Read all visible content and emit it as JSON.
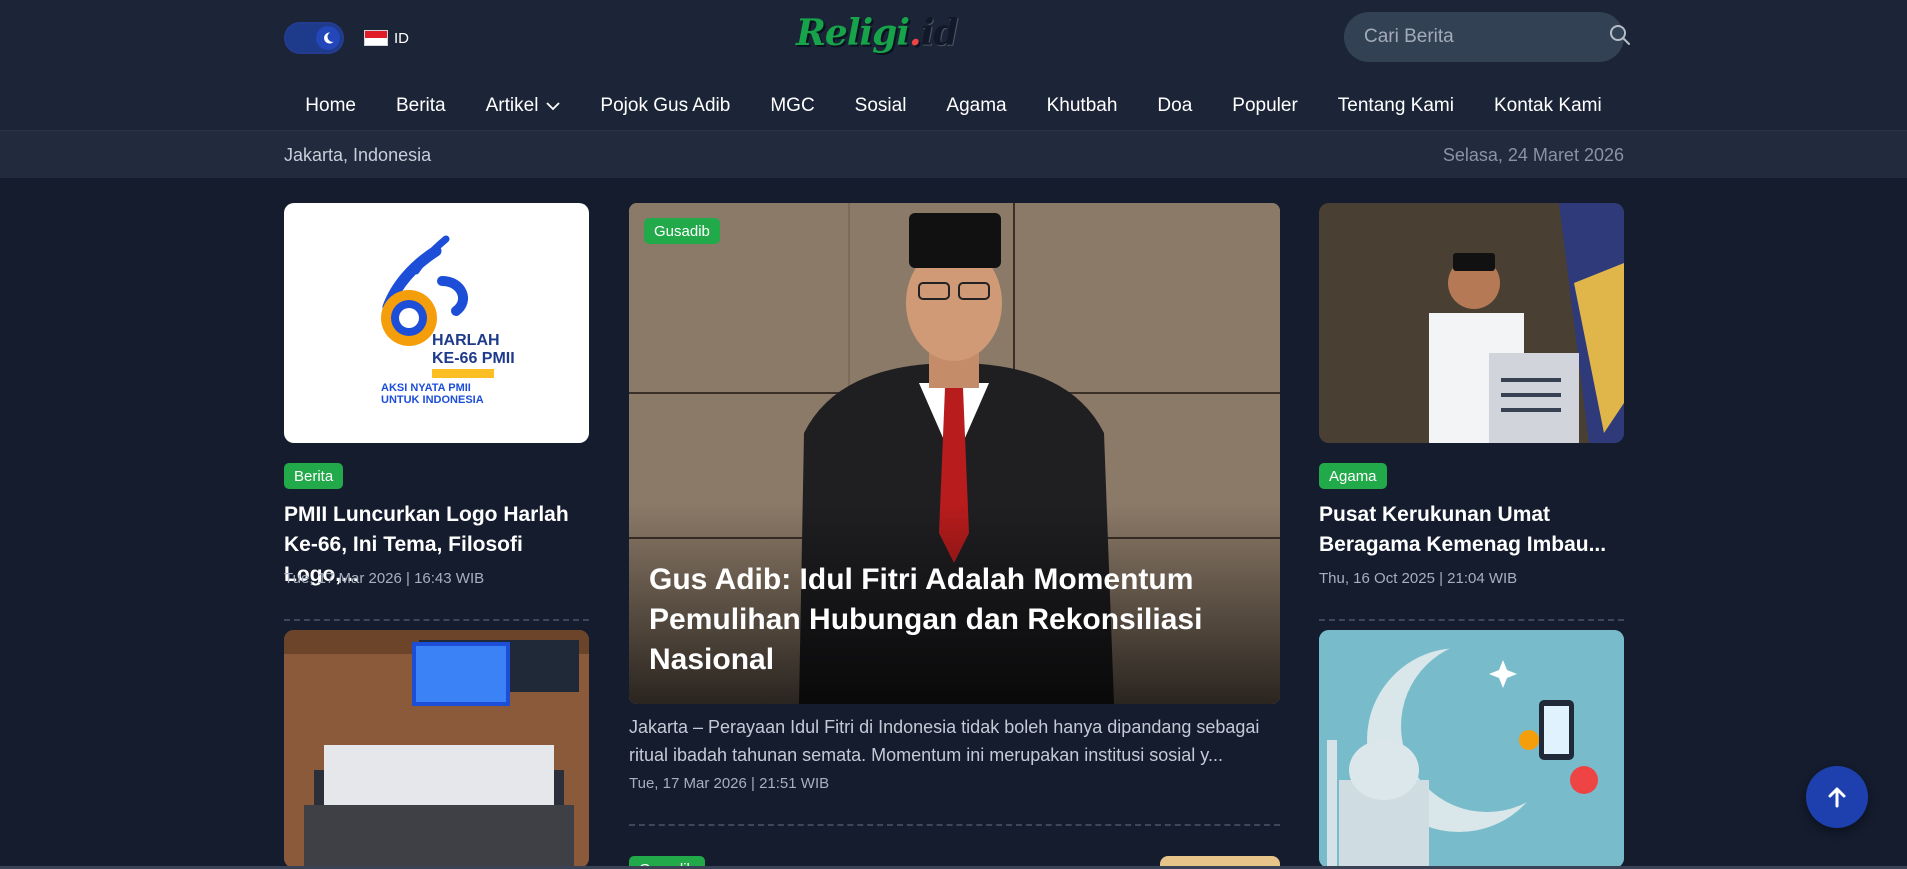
{
  "header": {
    "lang_code": "ID",
    "logo": {
      "part1": "Religi",
      "part2": ".",
      "part3": "id"
    },
    "search": {
      "placeholder": "Cari Berita"
    }
  },
  "nav": {
    "items": [
      {
        "label": "Home"
      },
      {
        "label": "Berita"
      },
      {
        "label": "Artikel",
        "has_dropdown": true
      },
      {
        "label": "Pojok Gus Adib"
      },
      {
        "label": "MGC"
      },
      {
        "label": "Sosial"
      },
      {
        "label": "Agama"
      },
      {
        "label": "Khutbah"
      },
      {
        "label": "Doa"
      },
      {
        "label": "Populer"
      },
      {
        "label": "Tentang Kami"
      },
      {
        "label": "Kontak Kami"
      }
    ]
  },
  "infobar": {
    "location": "Jakarta,  Indonesia",
    "date": "Selasa, 24 Maret 2026"
  },
  "left_column": {
    "card1": {
      "logo_text_1": "HARLAH",
      "logo_text_2": "KE-66 PMII",
      "logo_text_3": "AKSI NYATA PMII",
      "logo_text_4": "UNTUK INDONESIA",
      "badge": "Berita",
      "title": "PMII Luncurkan Logo Harlah Ke-66, Ini Tema, Filosofi Logo,...",
      "meta": "Tue, 17 Mar 2026 | 16:43 WIB"
    }
  },
  "hero": {
    "badge": "Gusadib",
    "title": "Gus Adib: Idul Fitri Adalah Momentum Pemulihan Hubungan dan Rekonsiliasi Nasional",
    "excerpt": "Jakarta – Perayaan Idul Fitri di Indonesia tidak boleh hanya dipandang sebagai ritual ibadah tahunan semata. Momentum ini merupakan institusi sosial y...",
    "meta": "Tue, 17 Mar 2026 | 21:51 WIB",
    "next_badge": "Gusadib"
  },
  "right_column": {
    "card1": {
      "badge": "Agama",
      "title": "Pusat Kerukunan Umat Beragama Kemenag Imbau...",
      "meta": "Thu, 16 Oct 2025 | 21:04 WIB"
    }
  },
  "colors": {
    "background": "#141c2e",
    "header": "#1c2537",
    "badge_green": "#22a94a",
    "fab_blue": "#1e40af"
  }
}
